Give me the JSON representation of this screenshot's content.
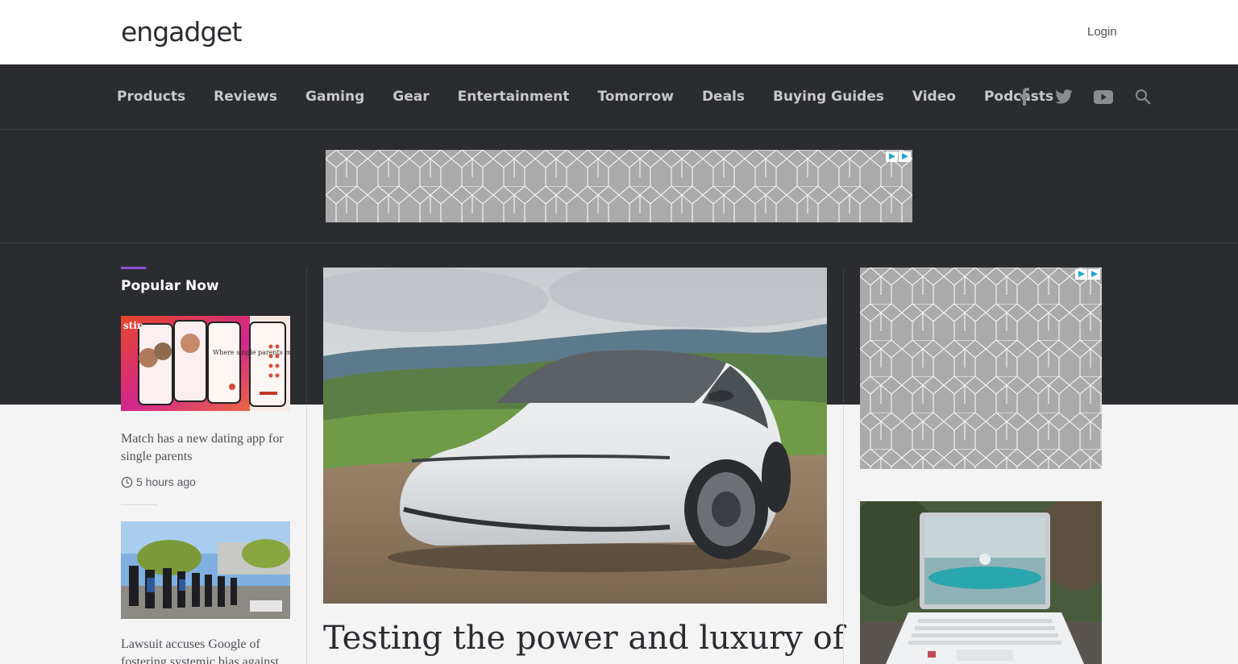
{
  "header": {
    "logo_text": "engadget",
    "login_label": "Login"
  },
  "nav": {
    "items": [
      {
        "label": "Products"
      },
      {
        "label": "Reviews"
      },
      {
        "label": "Gaming"
      },
      {
        "label": "Gear"
      },
      {
        "label": "Entertainment"
      },
      {
        "label": "Tomorrow"
      },
      {
        "label": "Deals"
      },
      {
        "label": "Buying Guides"
      },
      {
        "label": "Video"
      },
      {
        "label": "Podcasts"
      }
    ],
    "social_icons": [
      "facebook-icon",
      "twitter-icon",
      "youtube-icon",
      "search-icon"
    ]
  },
  "popular": {
    "heading": "Popular Now",
    "accent_color": "#8e4fd6",
    "items": [
      {
        "title": "Match has a new dating app for single parents",
        "time": "5 hours ago",
        "image_texts": [
          "stir",
          "Where single parents meet."
        ]
      },
      {
        "title": "Lawsuit accuses Google of fostering systemic bias against",
        "time": ""
      }
    ]
  },
  "hero": {
    "title": "Testing the power and luxury of"
  },
  "colors": {
    "nav_bg": "#2b2c30",
    "nav_text": "#c7c8ca",
    "page_bg": "#f4f4f5"
  }
}
